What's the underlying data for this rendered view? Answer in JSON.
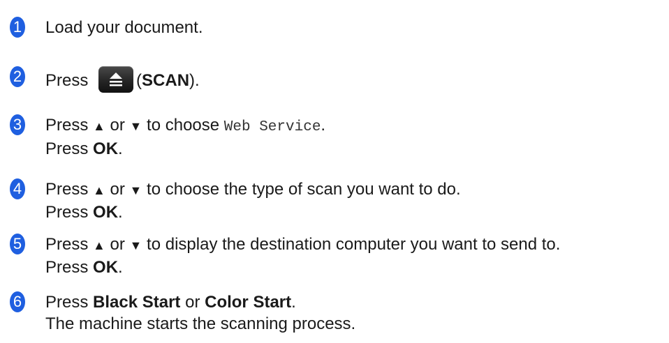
{
  "steps": [
    {
      "number": "1",
      "text": "Load your document."
    },
    {
      "number": "2",
      "press": "Press",
      "key_icon": "scan-key-icon",
      "key_open": "(",
      "key_label": "SCAN",
      "key_close": ")."
    },
    {
      "number": "3",
      "line1_press": "Press",
      "line1_up": "▲",
      "line1_or": "or",
      "line1_down": "▼",
      "line1_text": "to choose",
      "line1_option": "Web Service",
      "line1_end": ".",
      "line2_press": "Press",
      "line2_key": "OK",
      "line2_end": "."
    },
    {
      "number": "4",
      "line1_press": "Press",
      "line1_up": "▲",
      "line1_or": "or",
      "line1_down": "▼",
      "line1_text": "to choose the type of scan you want to do.",
      "line2_press": "Press",
      "line2_key": "OK",
      "line2_end": "."
    },
    {
      "number": "5",
      "line1_press": "Press",
      "line1_up": "▲",
      "line1_or": "or",
      "line1_down": "▼",
      "line1_text": "to display the destination computer you want to send to.",
      "line2_press": "Press",
      "line2_key": "OK",
      "line2_end": "."
    },
    {
      "number": "6",
      "line1_press": "Press",
      "line1_key1": "Black Start",
      "line1_or": "or",
      "line1_key2": "Color Start",
      "line1_end": ".",
      "line2_text": "The machine starts the scanning process."
    }
  ],
  "colors": {
    "badge": "#1f5fe0",
    "text": "#1a1a1a",
    "scan_key": "#262626"
  }
}
